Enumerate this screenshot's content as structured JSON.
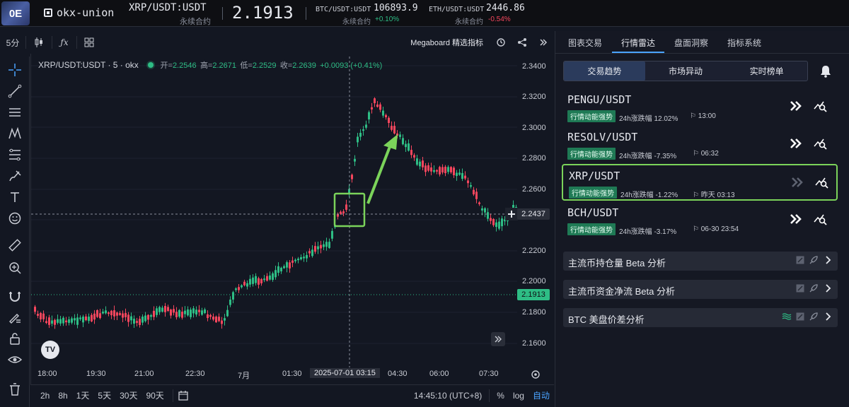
{
  "topbar": {
    "logo_text": "0E",
    "exchange": "okx-union",
    "symbol": "XRP/USDT:USDT",
    "symbol_sub": "永续合约",
    "price": "2.1913",
    "tickers": [
      {
        "symbol": "BTC/USDT:USDT",
        "price": "106893.9",
        "label": "永续合约",
        "change": "+0.10%"
      },
      {
        "symbol": "ETH/USDT:USDT",
        "price": "2446.86",
        "label": "永续合约",
        "change": "-0.54%"
      }
    ]
  },
  "toolbar": {
    "interval": "5分",
    "megaboard": "Megaboard 精选指标"
  },
  "legend": {
    "title": "XRP/USDT:USDT · 5 · okx",
    "open_k": "开=",
    "open_v": "2.2546",
    "high_k": "高=",
    "high_v": "2.2671",
    "low_k": "低=",
    "low_v": "2.2529",
    "close_k": "收=",
    "close_v": "2.2639",
    "change": "+0.0093 (+0.41%)"
  },
  "price_axis": {
    "labels": [
      "2.3400",
      "2.3200",
      "2.3000",
      "2.2800",
      "2.2600",
      "2.2400",
      "2.2200",
      "2.2000",
      "2.1800",
      "2.1600"
    ],
    "crosshair": "2.2437",
    "last": "2.1913"
  },
  "time_axis": {
    "labels": [
      "18:00",
      "19:30",
      "21:00",
      "22:30",
      "7月",
      "01:30",
      "2025-07-01  03:15",
      "04:30",
      "06:00",
      "07:30"
    ]
  },
  "bottom_bar": {
    "timeframes": [
      "2h",
      "8h",
      "1天",
      "5天",
      "30天",
      "90天"
    ],
    "clock": "14:45:10 (UTC+8)",
    "percent": "%",
    "log": "log",
    "auto": "自动"
  },
  "right_panel": {
    "tabs": [
      "图表交易",
      "行情雷达",
      "盘面洞察",
      "指标系统"
    ],
    "active_tab": "行情雷达",
    "segments": [
      "交易趋势",
      "市场异动",
      "实时榜单"
    ],
    "assets": [
      {
        "name": "PENGU/USDT",
        "badge": "行情动能强势",
        "change": "24h涨跌幅 12.02%",
        "time": "⚐ 13:00"
      },
      {
        "name": "RESOLV/USDT",
        "badge": "行情动能强势",
        "change": "24h涨跌幅 -7.35%",
        "time": "⚐ 06:32"
      },
      {
        "name": "XRP/USDT",
        "badge": "行情动能强势",
        "change": "24h涨跌幅 -1.22%",
        "time": "⚐ 昨天 03:13"
      },
      {
        "name": "BCH/USDT",
        "badge": "行情动能强势",
        "change": "24h涨跌幅 -3.17%",
        "time": "⚐ 06-30 23:54"
      }
    ],
    "analyses": [
      "主流币持仓量 Beta 分析",
      "主流币资金净流 Beta 分析",
      "BTC 美盘价差分析"
    ]
  },
  "colors": {
    "up": "#2ebd85",
    "down": "#f6465d",
    "highlight": "#7bd35a",
    "accent": "#4aa3ff"
  }
}
